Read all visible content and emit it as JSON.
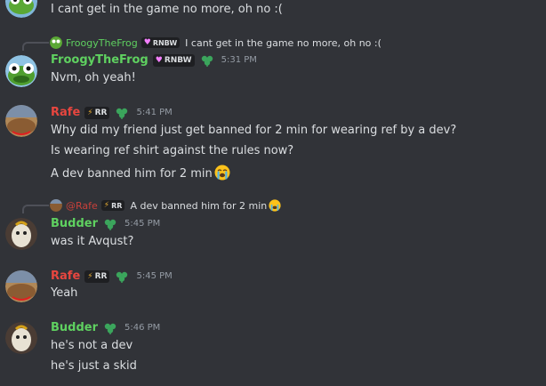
{
  "colors": {
    "background": "#313338",
    "green_name": "#5fd160",
    "red_name": "#e8463f",
    "text": "#dbdee1",
    "timestamp": "#949ba4"
  },
  "messages": [
    {
      "text": "I cant get in the game no more, oh no :("
    },
    {
      "reply": {
        "name": "FroogyTheFrog",
        "tag": "RNBW",
        "text": "I cant get in the game no more, oh no :("
      },
      "name": "FroogyTheFrog",
      "tag": "RNBW",
      "time": "5:31 PM",
      "lines": [
        "Nvm, oh yeah!"
      ]
    },
    {
      "name": "Rafe",
      "tag": "RR",
      "time": "5:41 PM",
      "lines": [
        "Why did my friend just get banned for 2 min for wearing ref by a dev?",
        "Is wearing ref shirt against the rules now?",
        "A dev banned him for 2 min"
      ]
    },
    {
      "reply": {
        "name": "@Rafe",
        "tag": "RR",
        "text": "A dev banned him for 2 min"
      },
      "name": "Budder",
      "time": "5:45 PM",
      "lines": [
        "was it Avqust?"
      ]
    },
    {
      "name": "Rafe",
      "tag": "RR",
      "time": "5:45 PM",
      "lines": [
        "Yeah"
      ]
    },
    {
      "name": "Budder",
      "time": "5:46 PM",
      "lines": [
        "he's not a dev",
        "he's just a skid"
      ]
    }
  ]
}
